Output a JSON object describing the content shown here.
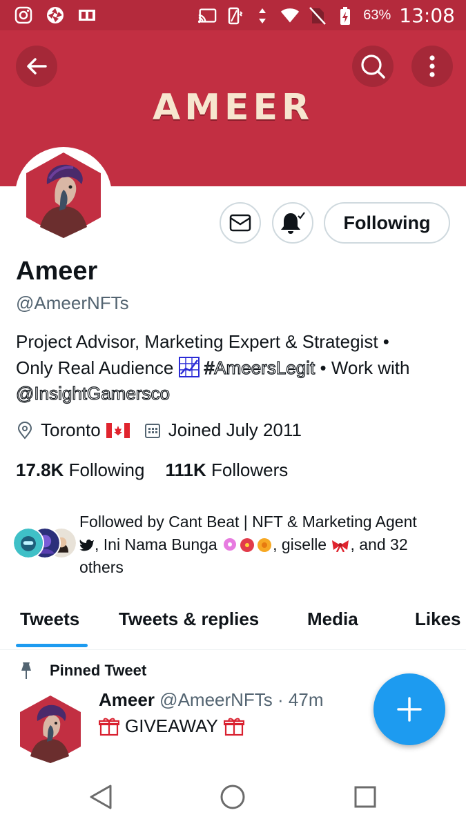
{
  "status_bar": {
    "battery": "63%",
    "time": "13:08",
    "left_icons": [
      "instagram-icon",
      "aperture-icon",
      "dual-square-icon"
    ],
    "right_icons": [
      "cast-icon",
      "vibrate-icon",
      "data-arrows-icon",
      "wifi-icon",
      "no-sim-icon",
      "battery-charging-icon"
    ]
  },
  "header": {
    "banner_title": "AMEER",
    "banner_color": "#c22f42"
  },
  "profile": {
    "display_name": "Ameer",
    "handle": "@AmeerNFTs",
    "bio_line1": "Project Advisor, Marketing Expert & Strategist •",
    "bio_line2_a": "Only Real Audience",
    "bio_hashtag": "#AmeersLegit",
    "bio_line2_b": "• Work with",
    "bio_mention": "@InsightGamersco",
    "location": "Toronto",
    "joined": "Joined July 2011",
    "following_count": "17.8K",
    "following_label": "Following",
    "followers_count": "111K",
    "followers_label": "Followers"
  },
  "actions": {
    "following_button": "Following"
  },
  "followed_by": {
    "line1": "Followed by Cant Beat | NFT & Marketing Agent",
    "line2_a": ", Ini Nama Bunga",
    "line2_b": ", giselle",
    "line2_c": ", and 32",
    "line3": "others"
  },
  "tabs": [
    {
      "label": "Tweets"
    },
    {
      "label": "Tweets & replies"
    },
    {
      "label": "Media"
    },
    {
      "label": "Likes"
    }
  ],
  "pinned": {
    "label": "Pinned Tweet",
    "author": "Ameer",
    "handle_time": "@AmeerNFTs · 47m",
    "text": "GIVEAWAY"
  },
  "colors": {
    "accent": "#1d9bf0",
    "banner": "#c22f42",
    "status_bar": "#b42a3c"
  }
}
